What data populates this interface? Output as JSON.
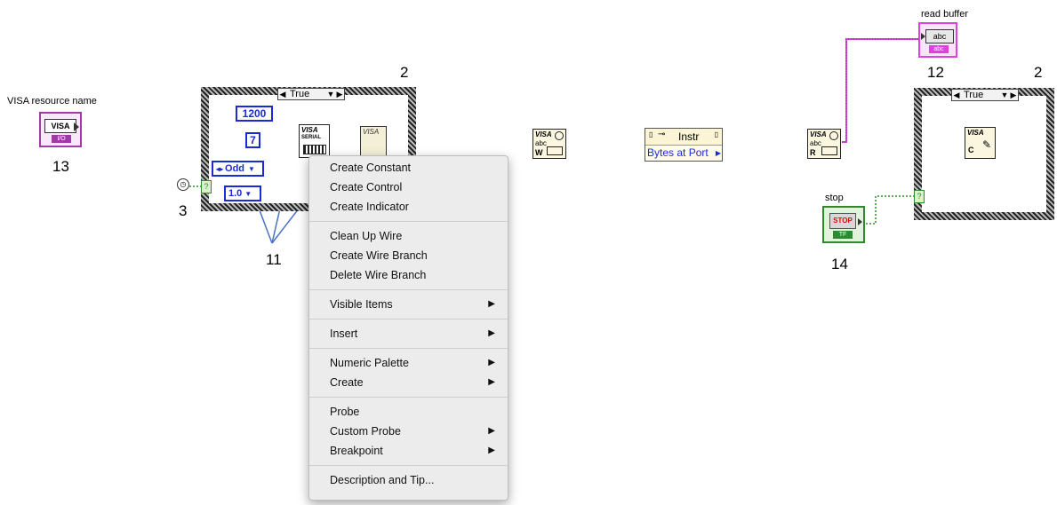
{
  "labels": {
    "visa_resource_name": "VISA resource name",
    "read_buffer": "read buffer",
    "stop": "stop"
  },
  "callouts": [
    "13",
    "2",
    "3",
    "11",
    "12",
    "2",
    "14"
  ],
  "case_structure_left": {
    "selector": "True"
  },
  "case_structure_right": {
    "selector": "True"
  },
  "constants": {
    "baud": "1200",
    "data_bits": "7",
    "parity": "Odd",
    "stop_bits": "1.0"
  },
  "icons": {
    "visa_resource_control_text": "VISA",
    "visa_resource_control_sub": "I/O",
    "visa_serial_text": "VISA",
    "visa_serial_sub": "SERIAL",
    "visa_write_text": "VISA",
    "visa_write_sub": "abc",
    "visa_write_letter": "W",
    "visa_read_text": "VISA",
    "visa_read_sub": "abc",
    "visa_read_letter": "R",
    "visa_close_text": "VISA",
    "visa_close_letter": "C",
    "read_buffer_text": "abc",
    "read_buffer_sub": "abc",
    "stop_button_text": "STOP",
    "stop_button_sub": "TF"
  },
  "property_node": {
    "class": "Instr",
    "property": "Bytes at Port"
  },
  "context_menu": {
    "items": [
      {
        "label": "Create Constant",
        "submenu": false
      },
      {
        "label": "Create Control",
        "submenu": false
      },
      {
        "label": "Create Indicator",
        "submenu": false
      },
      {
        "separator": true
      },
      {
        "label": "Clean Up Wire",
        "submenu": false
      },
      {
        "label": "Create Wire Branch",
        "submenu": false
      },
      {
        "label": "Delete Wire Branch",
        "submenu": false
      },
      {
        "separator": true
      },
      {
        "label": "Visible Items",
        "submenu": true
      },
      {
        "separator": true
      },
      {
        "label": "Insert",
        "submenu": true
      },
      {
        "separator": true
      },
      {
        "label": "Numeric Palette",
        "submenu": true
      },
      {
        "label": "Create",
        "submenu": true
      },
      {
        "separator": true
      },
      {
        "label": "Probe",
        "submenu": false
      },
      {
        "label": "Custom Probe",
        "submenu": true
      },
      {
        "label": "Breakpoint",
        "submenu": true
      },
      {
        "separator": true
      },
      {
        "label": "Description and Tip...",
        "submenu": false
      }
    ]
  },
  "colors": {
    "constant_blue": "#1a2bd6",
    "visa_purple": "#a13aa8",
    "string_pink": "#e040e0",
    "boolean_green": "#2f8a2f",
    "callout_arrow": "#4a72c4"
  }
}
